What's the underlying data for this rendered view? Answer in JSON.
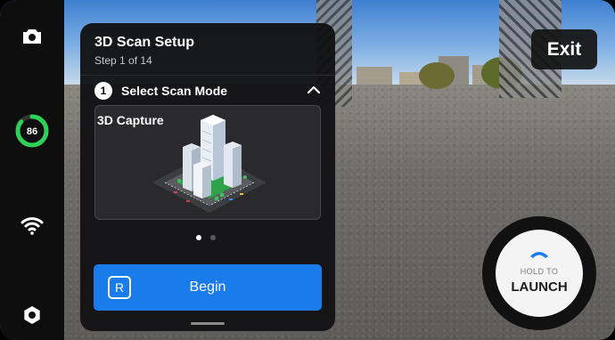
{
  "rail": {
    "battery_percent": "86",
    "battery_level": 0.86,
    "battery_color": "#2ed158"
  },
  "setup": {
    "title": "3D Scan Setup",
    "subtitle": "Step 1 of 14",
    "step_number": "1",
    "step_label": "Select Scan Mode",
    "mode_label": "3D Capture",
    "pager_total": 2,
    "pager_active": 1,
    "begin_key": "R",
    "begin_label": "Begin",
    "accent": "#1a7bea"
  },
  "exit_label": "Exit",
  "launch": {
    "hold_label": "HOLD TO",
    "action_label": "LAUNCH",
    "chevron_color": "#1a7bea"
  },
  "icons": {
    "camera": "camera-icon",
    "wifi": "wifi-icon",
    "settings": "gear-icon",
    "collapse": "chevron-up-icon",
    "launch": "chevron-up-icon"
  }
}
